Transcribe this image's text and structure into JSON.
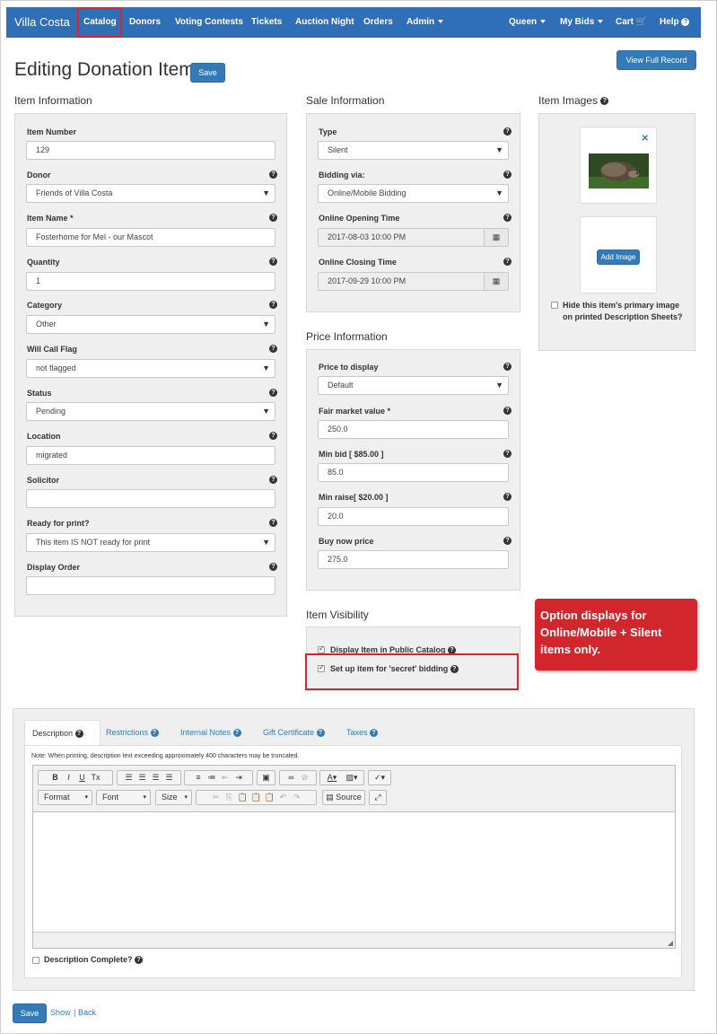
{
  "nav": {
    "brand": "Villa Costa",
    "items": [
      "Catalog",
      "Donors",
      "Voting Contests",
      "Tickets",
      "Auction Night",
      "Orders",
      "Admin"
    ],
    "right": [
      "Queen",
      "My Bids",
      "Cart",
      "Help"
    ]
  },
  "page": {
    "title": "Editing Donation Item",
    "save": "Save",
    "view_full_record": "View Full Record"
  },
  "item_info": {
    "heading": "Item Information",
    "item_number": {
      "label": "Item Number",
      "value": "129"
    },
    "donor": {
      "label": "Donor",
      "value": "Friends of Villa Costa"
    },
    "item_name": {
      "label": "Item Name *",
      "value": "Fosterhome for Mel - our Mascot"
    },
    "quantity": {
      "label": "Quantity",
      "value": "1"
    },
    "category": {
      "label": "Category",
      "value": "Other"
    },
    "will_call": {
      "label": "Will Call Flag",
      "value": "not flagged"
    },
    "status": {
      "label": "Status",
      "value": "Pending"
    },
    "location": {
      "label": "Location",
      "value": "migrated"
    },
    "solicitor": {
      "label": "Solicitor",
      "value": ""
    },
    "ready_for_print": {
      "label": "Ready for print?",
      "value": "This item IS NOT ready for print"
    },
    "display_order": {
      "label": "Display Order",
      "value": ""
    }
  },
  "sale_info": {
    "heading": "Sale Information",
    "type": {
      "label": "Type",
      "value": "Silent"
    },
    "bidding_via": {
      "label": "Bidding via:",
      "value": "Online/Mobile Bidding"
    },
    "opening": {
      "label": "Online Opening Time",
      "value": "2017-08-03 10:00 PM"
    },
    "closing": {
      "label": "Online Closing Time",
      "value": "2017-09-29 10:00 PM"
    }
  },
  "price_info": {
    "heading": "Price Information",
    "price_to_display": {
      "label": "Price to display",
      "value": "Default"
    },
    "fair_market": {
      "label": "Fair market value *",
      "value": "250.0"
    },
    "min_bid": {
      "label": "Min bid [ $85.00 ]",
      "value": "85.0"
    },
    "min_raise": {
      "label": "Min raise[ $20.00 ]",
      "value": "20.0"
    },
    "buy_now": {
      "label": "Buy now price",
      "value": "275.0"
    }
  },
  "visibility": {
    "heading": "Item Visibility",
    "public_catalog": "Display Item in Public Catalog",
    "secret_bidding": "Set up item for 'secret' bidding"
  },
  "images": {
    "heading": "Item Images",
    "add_image": "Add Image",
    "hide_primary": "Hide this item's primary image on printed Description Sheets?"
  },
  "callout": "Option displays for Online/Mobile + Silent items only.",
  "tabs": [
    "Description",
    "Restrictions",
    "Internal Notes",
    "Gift Certificate",
    "Taxes"
  ],
  "editor": {
    "note": "Note: When printing, description text exceeding approximately 400 characters may be truncated.",
    "format": "Format",
    "font": "Font",
    "size": "Size",
    "source": "Source",
    "description_complete": "Description Complete?"
  },
  "footer": {
    "save": "Save",
    "show": "Show",
    "separator": "|",
    "back": "Back"
  },
  "colors": {
    "navbar": "#2e6fb7",
    "primary": "#337ab7",
    "callout": "#d1262c"
  }
}
